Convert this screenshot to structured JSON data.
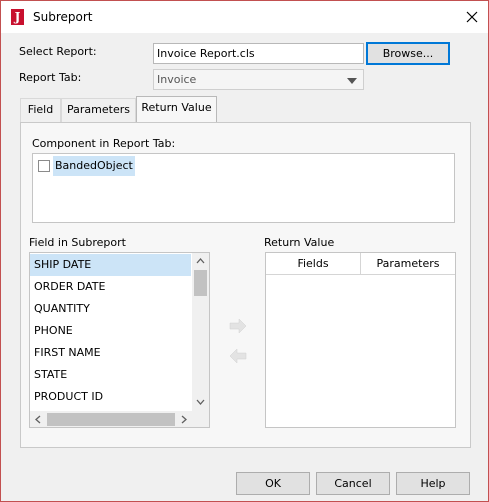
{
  "window": {
    "title": "Subreport",
    "close_label": "close"
  },
  "form": {
    "select_report_label": "Select Report:",
    "select_report_value": "Invoice Report.cls",
    "browse_label": "Browse...",
    "report_tab_label": "Report Tab:",
    "report_tab_value": "Invoice"
  },
  "tabs": [
    {
      "label": "Field"
    },
    {
      "label": "Parameters"
    },
    {
      "label": "Return Value",
      "active": true
    }
  ],
  "component": {
    "label": "Component in Report Tab:",
    "items": [
      {
        "label": "BandedObject",
        "checked": false
      }
    ]
  },
  "fields": {
    "label": "Field in Subreport",
    "items": [
      "SHIP DATE",
      "ORDER DATE",
      "QUANTITY",
      "PHONE",
      "FIRST NAME",
      "STATE",
      "PRODUCT ID"
    ],
    "selected": "SHIP DATE"
  },
  "return_value": {
    "label": "Return Value",
    "columns": [
      "Fields",
      "Parameters"
    ]
  },
  "footer": {
    "ok": "OK",
    "cancel": "Cancel",
    "help": "Help"
  },
  "icons": {
    "app": "report-app-icon",
    "close": "close-icon",
    "move_right": "arrow-right-icon",
    "move_left": "arrow-left-icon"
  },
  "colors": {
    "selection": "#cce4f7",
    "focus_border": "#0078d7",
    "window_border": "#c25050"
  }
}
